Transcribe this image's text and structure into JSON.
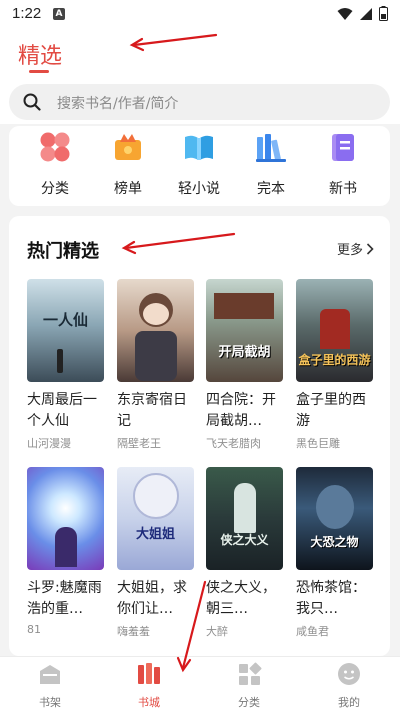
{
  "status": {
    "time": "1:22",
    "notif_letter": "A"
  },
  "header": {
    "title": "精选"
  },
  "search": {
    "placeholder": "搜索书名/作者/简介"
  },
  "categories": [
    {
      "label": "分类",
      "icon": "category-clover-icon"
    },
    {
      "label": "榜单",
      "icon": "ranking-crown-icon"
    },
    {
      "label": "轻小说",
      "icon": "light-novel-book-icon"
    },
    {
      "label": "完本",
      "icon": "finished-books-icon"
    },
    {
      "label": "新书",
      "icon": "new-book-icon"
    }
  ],
  "hot": {
    "title": "热门精选",
    "more": "更多",
    "books": [
      {
        "title": "大周最后一个人仙",
        "author": "山河漫漫",
        "cover_text": "一人仙"
      },
      {
        "title": "东京寄宿日记",
        "author": "隔壁老王",
        "cover_text": ""
      },
      {
        "title": "四合院：开局截胡…",
        "author": "飞天老腊肉",
        "cover_text": "开局截胡"
      },
      {
        "title": "盒子里的西游",
        "author": "黑色巨雕",
        "cover_text": "盒子里的西游"
      },
      {
        "title": "斗罗:魅魔雨浩的重…",
        "author": "81",
        "cover_text": ""
      },
      {
        "title": "大姐姐，求你们让…",
        "author": "嗨羞羞",
        "cover_text": "大姐姐"
      },
      {
        "title": "侠之大义，朝三…",
        "author": "大醉",
        "cover_text": "侠之大义"
      },
      {
        "title": "恐怖茶馆：我只…",
        "author": "咸鱼君",
        "cover_text": "大恐之物"
      }
    ]
  },
  "bottom_nav": [
    {
      "label": "书架",
      "icon": "bookshelf-icon",
      "active": false
    },
    {
      "label": "书城",
      "icon": "bookstore-icon",
      "active": true
    },
    {
      "label": "分类",
      "icon": "category-grid-icon",
      "active": false
    },
    {
      "label": "我的",
      "icon": "profile-icon",
      "active": false
    }
  ],
  "colors": {
    "accent": "#e24b43",
    "annotation": "#d7191c"
  }
}
